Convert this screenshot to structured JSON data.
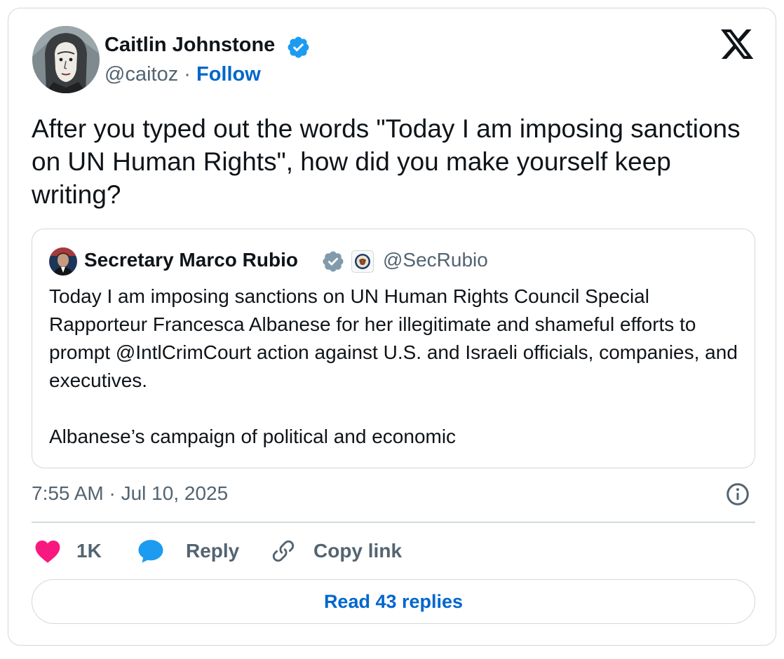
{
  "tweet": {
    "author": {
      "name": "Caitlin Johnstone",
      "handle": "@caitoz",
      "verified": true,
      "separator": "·",
      "follow_label": "Follow"
    },
    "text": "After you typed out the words \"Today I am imposing sanctions on UN Human Rights\", how did you make yourself keep writing?",
    "timestamp": "7:55 AM · Jul 10, 2025"
  },
  "quoted_tweet": {
    "author": {
      "name": "Secretary Marco Rubio",
      "handle": "@SecRubio",
      "verified": true,
      "affiliation_icon": "state-department-seal"
    },
    "paragraphs": [
      "Today I am imposing sanctions on UN Human Rights Council Special Rapporteur Francesca Albanese for her illegitimate and shameful efforts to prompt @IntlCrimCourt action against U.S. and Israeli officials, companies, and executives.",
      "Albanese’s campaign of political and economic"
    ]
  },
  "actions": {
    "like_count": "1K",
    "reply_label": "Reply",
    "copy_link_label": "Copy link"
  },
  "read_replies_label": "Read 43 replies",
  "icons": {
    "logo": "x-logo-icon",
    "verified": "verified-badge-icon",
    "info": "info-icon",
    "like": "heart-icon",
    "reply": "speech-bubble-icon",
    "copy_link": "link-icon"
  },
  "colors": {
    "accent": "#0066cc",
    "verified_blue": "#1d9bf0",
    "verified_gray": "#829aab",
    "like": "#f91880",
    "reply": "#1d9bf0",
    "secondary_text": "#536471",
    "border": "#cfd9de"
  }
}
